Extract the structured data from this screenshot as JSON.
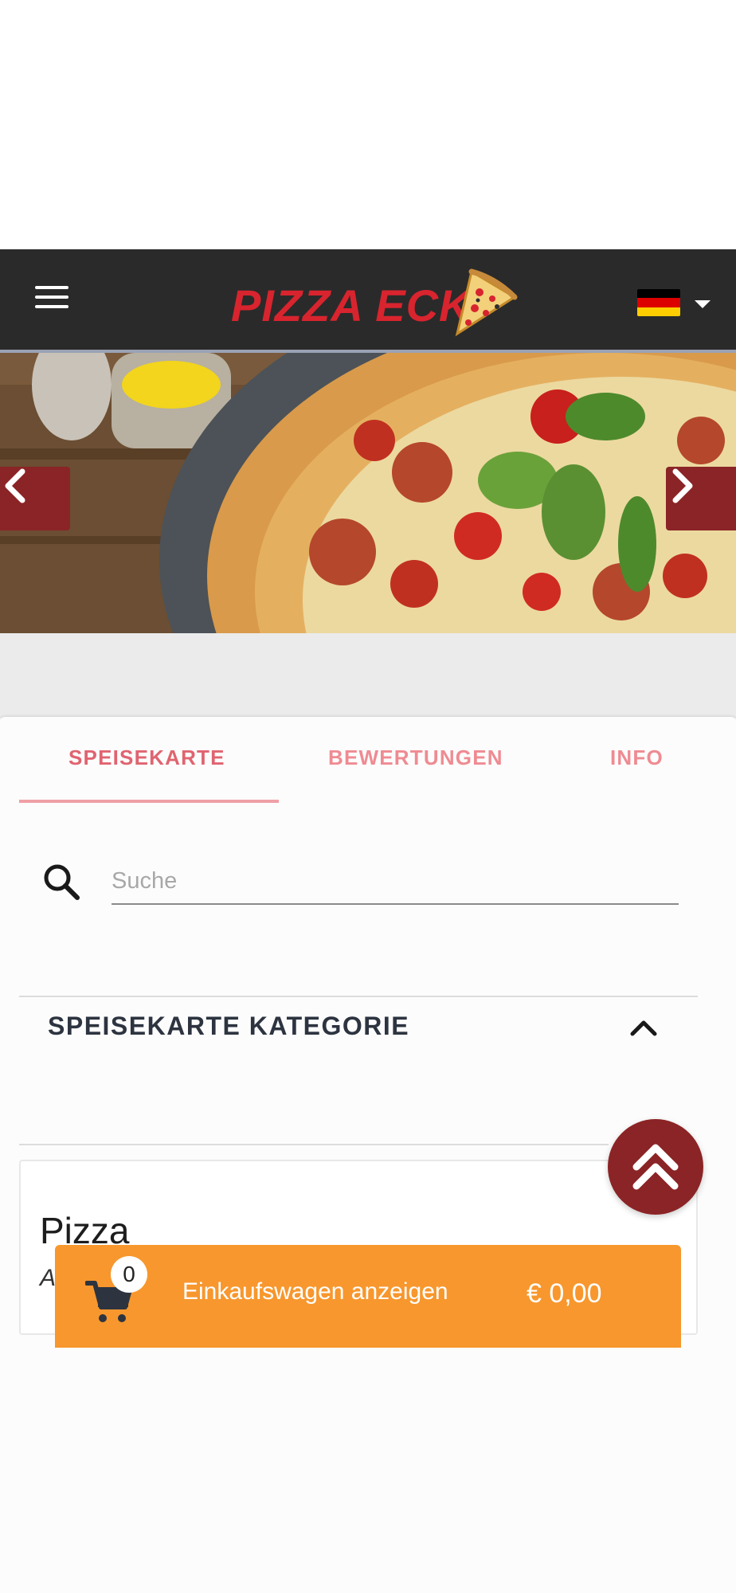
{
  "header": {
    "brand": "PIZZA ECK",
    "language": "Deutsch",
    "menu_icon": "hamburger-icon",
    "flag_colors": [
      "#000000",
      "#dd0000",
      "#ffce00"
    ]
  },
  "carousel": {
    "prev_icon": "chevron-left-icon",
    "next_icon": "chevron-right-icon"
  },
  "tabs": [
    {
      "label": "SPEISEKARTE",
      "active": true
    },
    {
      "label": "BEWERTUNGEN",
      "active": false
    },
    {
      "label": "INFO",
      "active": false
    }
  ],
  "search": {
    "placeholder": "Suche",
    "icon": "search-icon"
  },
  "category": {
    "title": "SPEISEKARTE KATEGORIE",
    "icon": "chevron-up-icon"
  },
  "card": {
    "title": "Pizza",
    "subtitle": "A"
  },
  "cart": {
    "count": "0",
    "label": "Einkaufswagen anzeigen",
    "total": "€ 0,00",
    "color": "#f7972d"
  },
  "colors": {
    "header_bg": "#2a2a2a",
    "brand_red": "#d8242e",
    "accent_maroon": "#8b2426",
    "tab_pink": "#e06470"
  }
}
